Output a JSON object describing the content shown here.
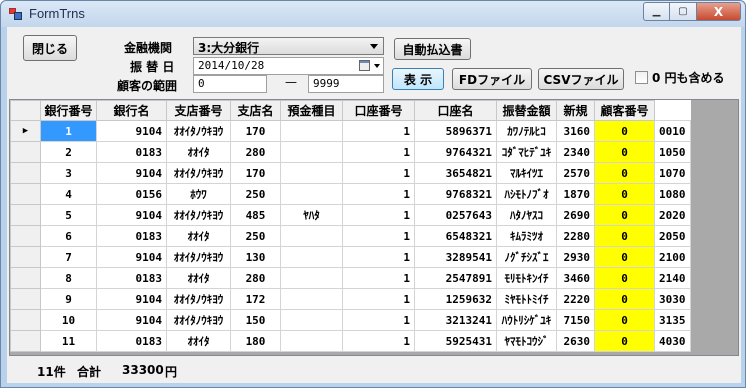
{
  "window": {
    "title": "FormTrns",
    "min_label": "▁",
    "max_label": "▢",
    "close_label": "X"
  },
  "controls": {
    "close_button": "閉じる",
    "bank_label": "金融機関",
    "bank_value": "3:大分銀行",
    "date_label": "振 替 日",
    "date_value": "2014/10/28",
    "range_label": "顧客の範囲",
    "range_from": "0",
    "range_sep": "—",
    "range_to": "9999",
    "auto_button": "自動払込書",
    "show_button": "表 示",
    "fd_button": "FDファイル",
    "csv_button": "CSVファイル",
    "include_zero_label": "0 円も含める",
    "include_zero_checked": false
  },
  "table": {
    "columns": [
      "銀行番号",
      "銀行名",
      "支店番号",
      "支店名",
      "預金種目",
      "口座番号",
      "口座名",
      "振替金額",
      "新規",
      "顧客番号"
    ],
    "rows": [
      [
        "1",
        "9104",
        "ｵｵｲﾀﾉｳｷﾖｳ",
        "170",
        "",
        "1",
        "5896371",
        "ｶﾜﾉﾃﾙﾋｺ",
        "3160",
        "0",
        "0010"
      ],
      [
        "2",
        "0183",
        "ｵｵｲﾀ",
        "280",
        "",
        "1",
        "9764321",
        "ｺﾀﾞﾏﾋﾃﾞﾕｷ",
        "2340",
        "0",
        "1050"
      ],
      [
        "3",
        "9104",
        "ｵｵｲﾀﾉｳｷﾖｳ",
        "170",
        "",
        "1",
        "3654821",
        "ﾏﾙｷｲﾂｴ",
        "2570",
        "0",
        "1070"
      ],
      [
        "4",
        "0156",
        "ﾎｳﾜ",
        "250",
        "",
        "1",
        "9768321",
        "ﾊｼﾓﾄﾉﾌﾞｵ",
        "1870",
        "0",
        "1080"
      ],
      [
        "5",
        "9104",
        "ｵｵｲﾀﾉｳｷﾖｳ",
        "485",
        "ﾔﾊﾀ",
        "1",
        "0257643",
        "ﾊﾀﾉﾔｽｺ",
        "2690",
        "0",
        "2020"
      ],
      [
        "6",
        "0183",
        "ｵｵｲﾀ",
        "250",
        "",
        "1",
        "6548321",
        "ｷﾑﾗﾐﾂｵ",
        "2280",
        "0",
        "2050"
      ],
      [
        "7",
        "9104",
        "ｵｵｲﾀﾉｳｷﾖｳ",
        "130",
        "",
        "1",
        "3289541",
        "ﾉｸﾞﾁｼｽﾞｴ",
        "2930",
        "0",
        "2100"
      ],
      [
        "8",
        "0183",
        "ｵｵｲﾀ",
        "280",
        "",
        "1",
        "2547891",
        "ﾓﾘﾓﾄｷﾝｲﾁ",
        "3460",
        "0",
        "2140"
      ],
      [
        "9",
        "9104",
        "ｵｵｲﾀﾉｳｷﾖｳ",
        "172",
        "",
        "1",
        "1259632",
        "ﾐﾔﾓﾄﾄﾐｲﾁ",
        "2220",
        "0",
        "3030"
      ],
      [
        "10",
        "9104",
        "ｵｵｲﾀﾉｳｷﾖｳ",
        "150",
        "",
        "1",
        "3213241",
        "ﾊｳﾄﾘｼｹﾞﾕｷ",
        "7150",
        "0",
        "3135"
      ],
      [
        "11",
        "0183",
        "ｵｵｲﾀ",
        "180",
        "",
        "1",
        "5925431",
        "ﾔﾏﾓﾄｺｳｼﾞ",
        "2630",
        "0",
        "4030"
      ]
    ],
    "current_row_marker": "▶"
  },
  "status": {
    "count": "11件",
    "total_label": "合計",
    "total_value": "33300",
    "unit": "円"
  },
  "colors": {
    "selected_cell": "#3399ff",
    "new_column": "#ffff00",
    "grid_background": "#a9a9a9"
  }
}
